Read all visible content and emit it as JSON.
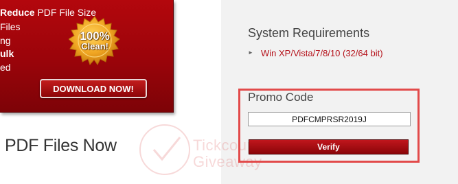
{
  "banner": {
    "features": [
      {
        "bold": "Reduce",
        "rest": " PDF File Size"
      },
      {
        "bold": "",
        "rest": "Files"
      },
      {
        "bold": "",
        "rest": "ng"
      },
      {
        "bold": "ulk",
        "rest": ""
      },
      {
        "bold": "",
        "rest": "ed"
      }
    ],
    "seal_percent": "100%",
    "seal_label": "Clean!",
    "download_label": "DOWNLOAD NOW!"
  },
  "main": {
    "heading": "PDF Files Now"
  },
  "sidebar": {
    "requirements_title": "System Requirements",
    "requirements_item": "Win XP/Vista/7/8/10 (32/64 bit)",
    "promo_title": "Promo Code",
    "promo_code": "PDFCMPRSR2019J",
    "verify_label": "Verify"
  },
  "watermark": {
    "line1": "Tickcoupon",
    "line2": "Giveaway"
  },
  "colors": {
    "banner_red": "#a0050b",
    "link_red": "#b5121b",
    "highlight": "#e24a4a",
    "seal_gold": "#f0a623",
    "sidebar_bg": "#f2f2f2"
  }
}
